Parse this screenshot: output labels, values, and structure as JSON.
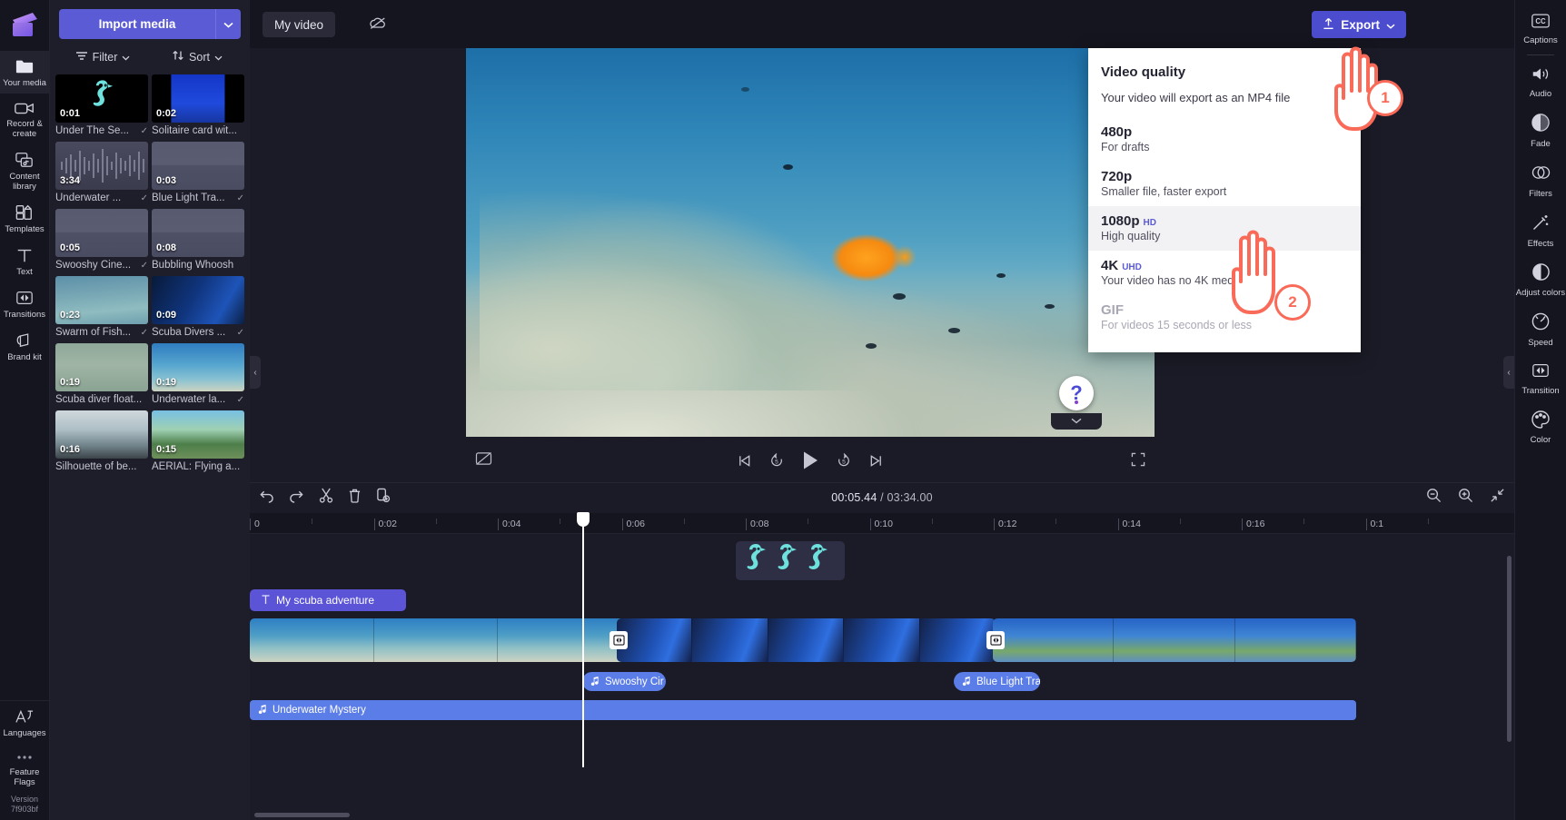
{
  "app": {
    "logo_icon": "clipchamp-logo-icon",
    "version": "Version\n7f903bf"
  },
  "left_rail": {
    "items": [
      {
        "label": "Your media",
        "icon": "folder-icon",
        "active": true
      },
      {
        "label": "Record & create",
        "icon": "video-camera-icon",
        "active": false
      },
      {
        "label": "Content library",
        "icon": "content-library-icon",
        "active": false
      },
      {
        "label": "Templates",
        "icon": "templates-icon",
        "active": false
      },
      {
        "label": "Text",
        "icon": "text-icon",
        "active": false
      },
      {
        "label": "Transitions",
        "icon": "transitions-icon",
        "active": false
      },
      {
        "label": "Brand kit",
        "icon": "brand-kit-icon",
        "active": false
      }
    ],
    "bottom_items": [
      {
        "label": "Languages",
        "icon": "languages-icon"
      },
      {
        "label": "Feature Flags",
        "icon": "ellipsis-icon"
      }
    ]
  },
  "media_panel": {
    "import_label": "Import media",
    "import_caret_icon": "chevron-down-icon",
    "filter_label": "Filter",
    "filter_icon": "filter-icon",
    "sort_label": "Sort",
    "sort_icon": "sort-arrows-icon",
    "items": [
      {
        "duration": "0:01",
        "name": "Under The Se...",
        "art": "a-seahorse",
        "checked": true
      },
      {
        "duration": "0:02",
        "name": "Solitaire card wit...",
        "art": "a-solitaire",
        "checked": false
      },
      {
        "duration": "3:34",
        "name": "Underwater ...",
        "art": "a-wave",
        "checked": true
      },
      {
        "duration": "0:03",
        "name": "Blue Light Tra...",
        "art": "a-flat",
        "checked": true
      },
      {
        "duration": "0:05",
        "name": "Swooshy Cine...",
        "art": "a-flat",
        "checked": true
      },
      {
        "duration": "0:08",
        "name": "Bubbling Whoosh",
        "art": "a-flat",
        "checked": false
      },
      {
        "duration": "0:23",
        "name": "Swarm of Fish...",
        "art": "a-fish",
        "checked": true
      },
      {
        "duration": "0:09",
        "name": "Scuba Divers ...",
        "art": "a-diver",
        "checked": true
      },
      {
        "duration": "0:19",
        "name": "Scuba diver float...",
        "art": "a-sdiver",
        "checked": false
      },
      {
        "duration": "0:19",
        "name": "Underwater la...",
        "art": "a-reef",
        "checked": true
      },
      {
        "duration": "0:16",
        "name": "Silhouette of be...",
        "art": "a-silh",
        "checked": false
      },
      {
        "duration": "0:15",
        "name": "AERIAL: Flying a...",
        "art": "a-aerial",
        "checked": false
      }
    ]
  },
  "topbar": {
    "project_tab": "My video",
    "cloud_icon": "cloud-offline-icon",
    "export_label": "Export",
    "export_icon": "upload-arrow-icon",
    "export_caret_icon": "chevron-down-icon"
  },
  "export_menu": {
    "title": "Video quality",
    "subtitle": "Your video will export as an MP4 file",
    "options": [
      {
        "label": "480p",
        "tag": "",
        "desc": "For drafts",
        "selected": false,
        "disabled": false
      },
      {
        "label": "720p",
        "tag": "",
        "desc": "Smaller file, faster export",
        "selected": false,
        "disabled": false
      },
      {
        "label": "1080p",
        "tag": "HD",
        "desc": "High quality",
        "selected": true,
        "disabled": false
      },
      {
        "label": "4K",
        "tag": "UHD",
        "desc": "Your video has no 4K media",
        "selected": false,
        "disabled": false
      },
      {
        "label": "GIF",
        "tag": "",
        "desc": "For videos 15 seconds or less",
        "selected": false,
        "disabled": true
      }
    ]
  },
  "annotations": [
    {
      "number": "1",
      "target": "export-button"
    },
    {
      "number": "2",
      "target": "1080p-option"
    }
  ],
  "player": {
    "captions_off_icon": "captions-off-icon",
    "skip_start_icon": "skip-to-start-icon",
    "back5_icon": "rewind-5-icon",
    "play_icon": "play-icon",
    "forward5_icon": "forward-5-icon",
    "skip_end_icon": "skip-to-end-icon",
    "fullscreen_icon": "fullscreen-icon",
    "help_icon": "help-question-icon",
    "collapse_icon": "chevron-down-icon"
  },
  "right_rail": {
    "items": [
      {
        "label": "Captions",
        "icon": "captions-cc-icon"
      },
      {
        "label": "Audio",
        "icon": "audio-speaker-icon"
      },
      {
        "label": "Fade",
        "icon": "fade-icon"
      },
      {
        "label": "Filters",
        "icon": "filters-icon"
      },
      {
        "label": "Effects",
        "icon": "effects-wand-icon"
      },
      {
        "label": "Adjust colors",
        "icon": "adjust-colors-icon"
      },
      {
        "label": "Speed",
        "icon": "speed-gauge-icon"
      },
      {
        "label": "Transition",
        "icon": "transition-icon"
      },
      {
        "label": "Color",
        "icon": "color-palette-icon"
      }
    ]
  },
  "timeline": {
    "tools": [
      {
        "name": "undo",
        "icon": "undo-icon"
      },
      {
        "name": "redo",
        "icon": "redo-icon"
      },
      {
        "name": "split",
        "icon": "scissors-icon"
      },
      {
        "name": "delete",
        "icon": "trash-icon"
      },
      {
        "name": "duplicate",
        "icon": "duplicate-icon"
      }
    ],
    "current_time": "00:05.44",
    "total_time": "/ 03:34.00",
    "zoom_out_icon": "zoom-out-icon",
    "zoom_in_icon": "zoom-in-icon",
    "fit_icon": "fit-to-screen-icon",
    "ruler_ticks": [
      "0",
      "0:02",
      "0:04",
      "0:06",
      "0:08",
      "0:10",
      "0:12",
      "0:14",
      "0:16",
      "0:1"
    ],
    "playhead_time": "00:05.44",
    "clips": {
      "sticker": {
        "name": "seahorse-sticker",
        "icon": "seahorse-icon",
        "count": 3
      },
      "text": {
        "label": "My scuba adventure",
        "icon": "text-t-icon"
      },
      "audio_1": {
        "label": "Swooshy Cir",
        "icon": "music-note-icon"
      },
      "audio_2": {
        "label": "Blue Light Tra",
        "icon": "music-note-icon"
      },
      "audio_3": {
        "label": "Underwater Mystery",
        "icon": "music-note-icon"
      },
      "transition_icon": "transition-icon"
    }
  },
  "colors": {
    "accent": "#5b5bd6",
    "export_button": "#4c4cce",
    "annotation": "#f96a58",
    "audio_clip": "#5b7de8",
    "text_clip": "#5b54d6",
    "panel_bg": "#1e1e2a",
    "app_bg": "#1b1b27",
    "rail_bg": "#15151f"
  }
}
